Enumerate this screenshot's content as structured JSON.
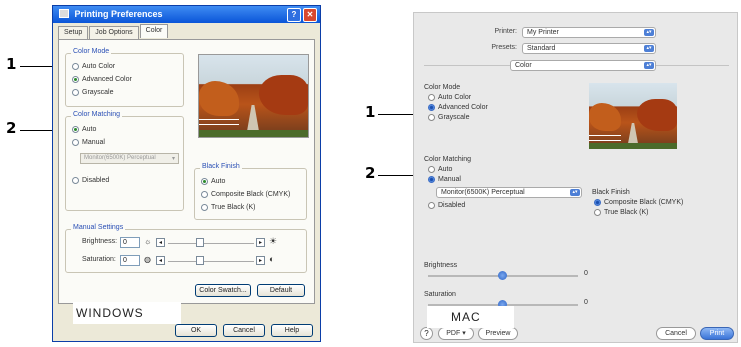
{
  "windows": {
    "caption": "WINDOWS",
    "title": "Printing Preferences",
    "tabs": [
      "Setup",
      "Job Options",
      "Color"
    ],
    "color_mode": {
      "label": "Color Mode",
      "options": [
        "Auto Color",
        "Advanced Color",
        "Grayscale"
      ],
      "selected": "Advanced Color"
    },
    "color_matching": {
      "label": "Color Matching",
      "options": [
        "Auto",
        "Manual",
        "Disabled"
      ],
      "selected": "Auto",
      "dropdown_value": "Monitor(6500K) Perceptual"
    },
    "black_finish": {
      "label": "Black Finish",
      "options": [
        "Auto",
        "Composite Black (CMYK)",
        "True Black (K)"
      ],
      "selected": "Auto"
    },
    "manual_settings": {
      "label": "Manual Settings",
      "brightness_label": "Brightness:",
      "brightness_value": "0",
      "saturation_label": "Saturation:",
      "saturation_value": "0"
    },
    "buttons": {
      "color_swatch": "Color Swatch...",
      "default": "Default",
      "ok": "OK",
      "cancel": "Cancel",
      "help": "Help"
    }
  },
  "mac": {
    "caption": "MAC",
    "printer_label": "Printer:",
    "printer_value": "My Printer",
    "presets_label": "Presets:",
    "presets_value": "Standard",
    "panel_value": "Color",
    "color_mode": {
      "label": "Color Mode",
      "options": [
        "Auto Color",
        "Advanced Color",
        "Grayscale"
      ],
      "selected": "Advanced Color"
    },
    "color_matching": {
      "label": "Color Matching",
      "options": [
        "Auto",
        "Manual",
        "Disabled"
      ],
      "selected": "Manual",
      "dropdown_value": "Monitor(6500K) Perceptual"
    },
    "black_finish": {
      "label": "Black Finish",
      "options": [
        "Composite Black (CMYK)",
        "True Black (K)"
      ],
      "selected": "Composite Black (CMYK)"
    },
    "brightness_label": "Brightness",
    "brightness_value": "0",
    "saturation_label": "Saturation",
    "saturation_value": "0",
    "buttons": {
      "help": "?",
      "pdf": "PDF ▾",
      "preview": "Preview",
      "cancel": "Cancel",
      "print": "Print"
    }
  },
  "callouts": {
    "left_1": "1",
    "left_2": "2",
    "right_1": "1",
    "right_2": "2"
  }
}
